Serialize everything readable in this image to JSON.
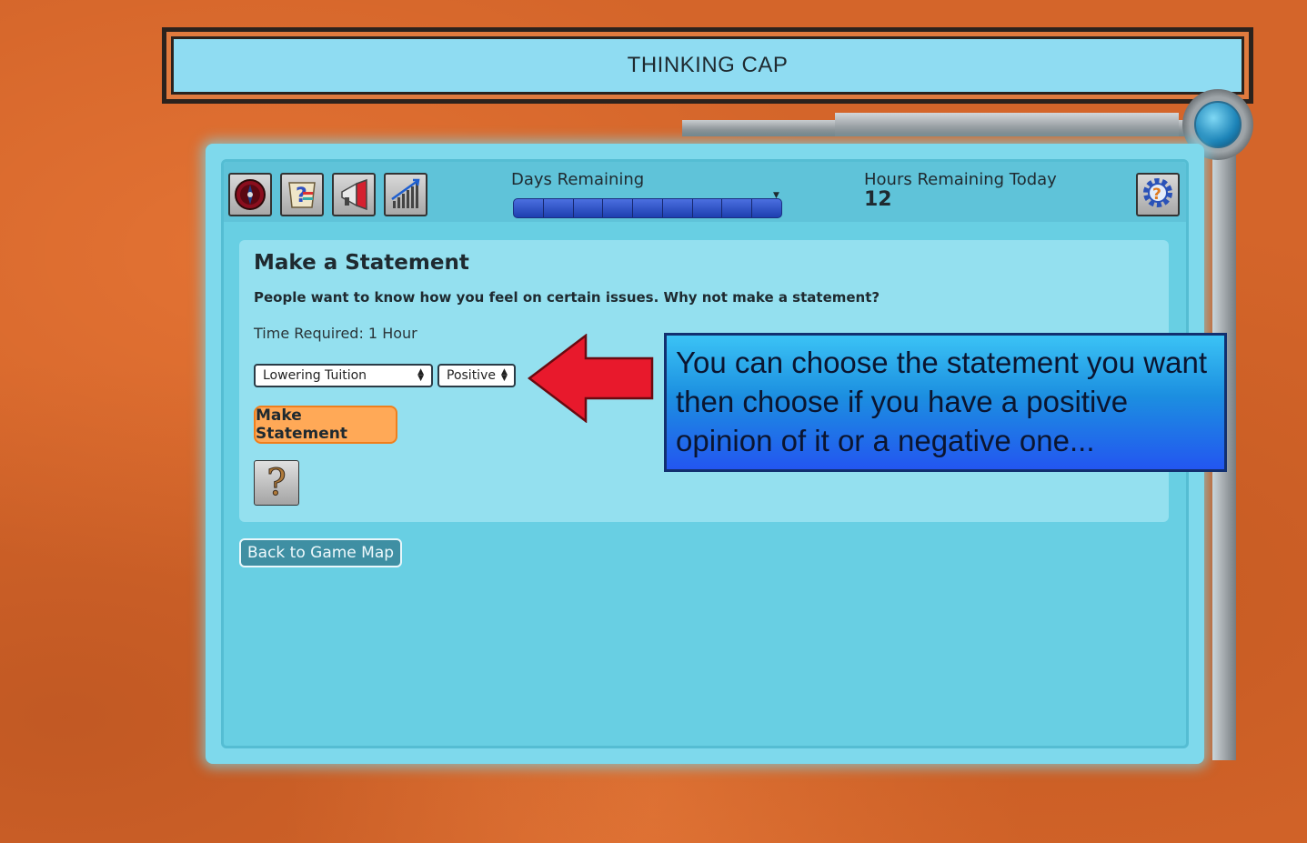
{
  "header": {
    "title": "THINKING CAP"
  },
  "toolbar": {
    "icons": [
      "compass-icon",
      "quiz-map-icon",
      "megaphone-icon",
      "poll-chart-icon"
    ],
    "days_label": "Days Remaining",
    "days_segments": 9,
    "hours_label": "Hours Remaining Today",
    "hours_value": "12",
    "settings_icon": "gear-help-icon"
  },
  "action": {
    "title": "Make a Statement",
    "description": "People want to know how you feel on certain issues. Why not make a statement?",
    "time_required": "Time Required: 1 Hour",
    "issue_select": {
      "selected": "Lowering Tuition"
    },
    "opinion_select": {
      "selected": "Positive"
    },
    "submit_label": "Make Statement",
    "help_symbol": "?"
  },
  "navigation": {
    "back_label": "Back to Game Map"
  },
  "callout": {
    "text": "You can choose the statement you want then choose if you have a positive opinion of it or a negative one..."
  },
  "colors": {
    "accent_orange": "#ffa957",
    "panel": "#7ed9ec",
    "callout_blue": "#2356f0",
    "arrow_red": "#e8192c"
  }
}
